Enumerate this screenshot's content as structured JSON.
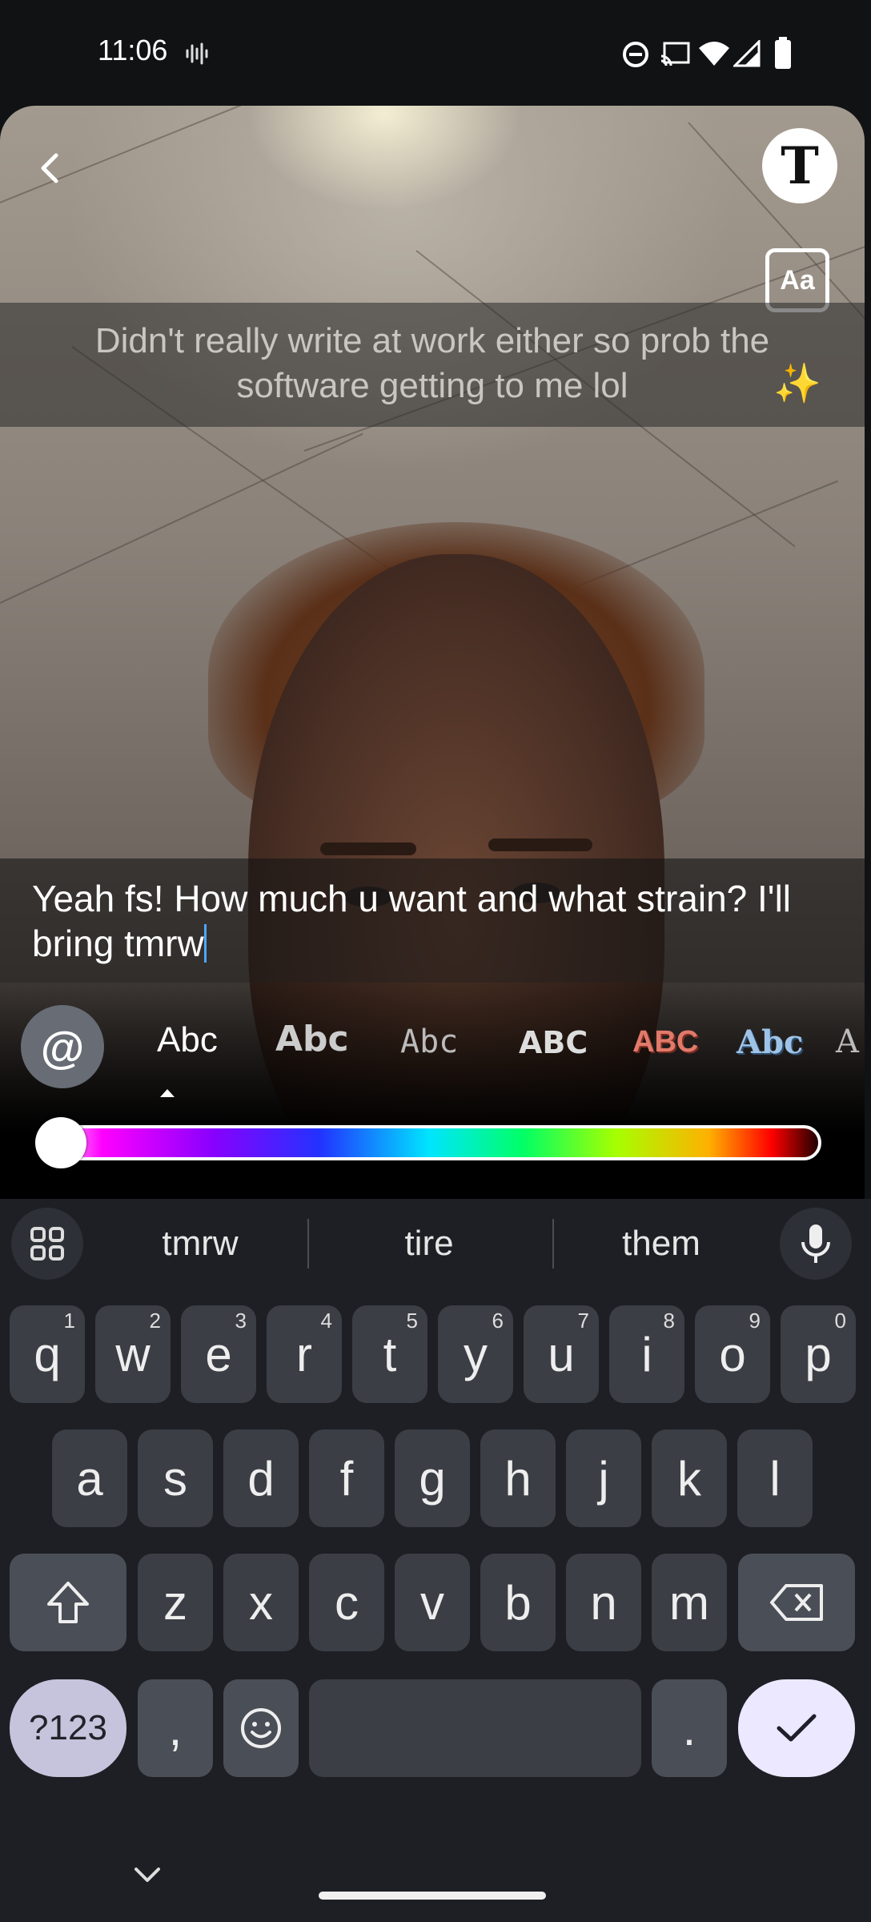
{
  "status_bar": {
    "time": "11:06",
    "icons": [
      "voice-wave-icon",
      "do-not-disturb-icon",
      "cast-icon",
      "wifi-icon",
      "signal-icon",
      "battery-icon"
    ]
  },
  "editor": {
    "reply_context": "Didn't really write at work either so prob the software getting to me lol",
    "reply_emoji": "✨",
    "input_text": "Yeah fs! How much u want and what strain? I'll bring tmrw",
    "text_tool_label": "T",
    "font_toggle_label": "Aa",
    "mention_label": "@",
    "font_styles": [
      "Abc",
      "Abc",
      "Abc",
      "ABC",
      "ABC",
      "Abc",
      "A"
    ],
    "selected_font_index": 0,
    "color_slider_value": 0
  },
  "keyboard": {
    "suggestions": [
      "tmrw",
      "tire",
      "them"
    ],
    "row1": [
      "q",
      "w",
      "e",
      "r",
      "t",
      "y",
      "u",
      "i",
      "o",
      "p"
    ],
    "row1_hints": [
      "1",
      "2",
      "3",
      "4",
      "5",
      "6",
      "7",
      "8",
      "9",
      "0"
    ],
    "row2": [
      "a",
      "s",
      "d",
      "f",
      "g",
      "h",
      "j",
      "k",
      "l"
    ],
    "row3": [
      "z",
      "x",
      "c",
      "v",
      "b",
      "n",
      "m"
    ],
    "mode_key": "?123",
    "comma_key": ",",
    "period_key": "."
  },
  "colors": {
    "accent": "#4ea6ff",
    "keyboard_bg": "#1d1f24",
    "key_bg": "#3b3e45",
    "enter_bg": "#ece8ff"
  }
}
